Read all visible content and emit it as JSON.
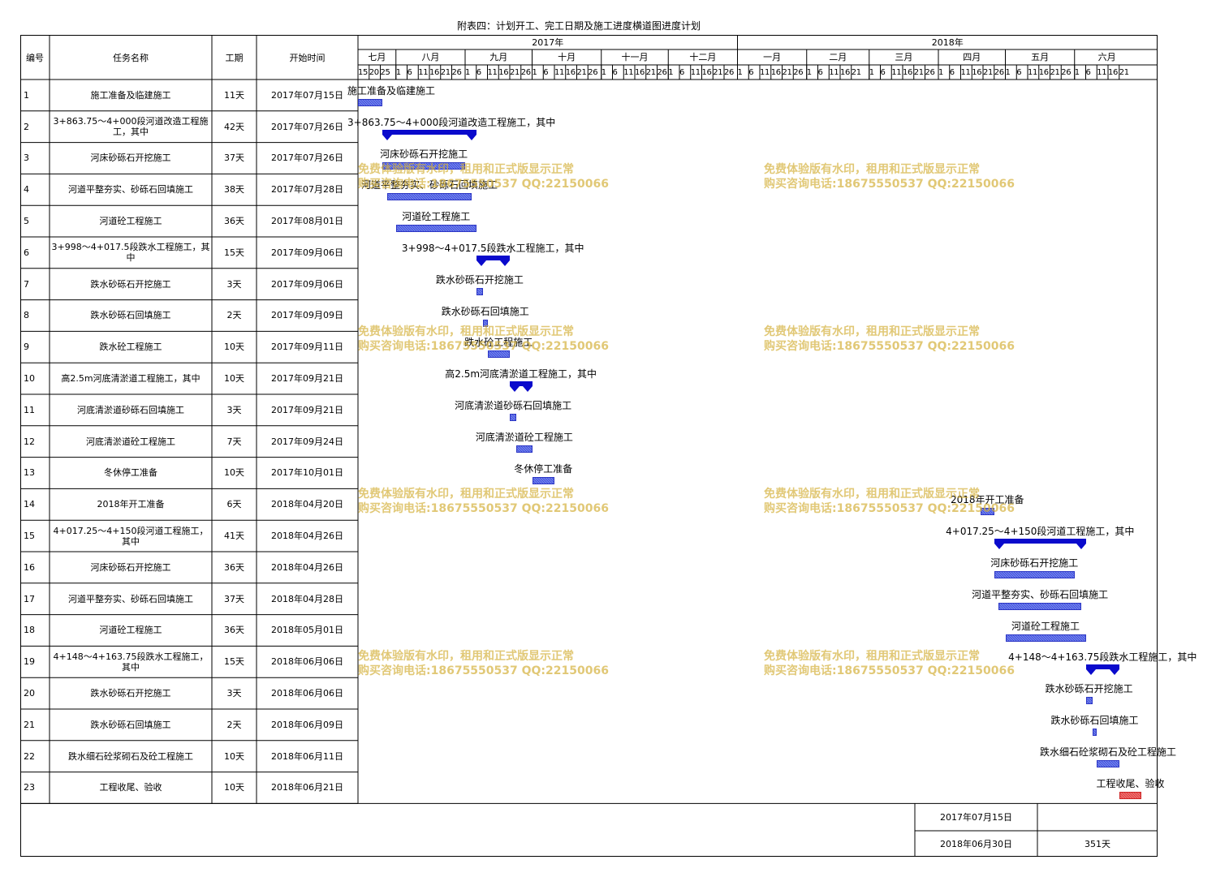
{
  "title": "附表四：计划开工、完工日期及施工进度横道图进度计划",
  "headers": {
    "id": "编号",
    "name": "任务名称",
    "duration": "工期",
    "start": "开始时间"
  },
  "years": [
    "2017年",
    "2018年"
  ],
  "months": [
    "七月",
    "八月",
    "九月",
    "十月",
    "十一月",
    "十二月",
    "一月",
    "二月",
    "三月",
    "四月",
    "五月",
    "六月"
  ],
  "day_ticks": [
    [
      "15",
      "20",
      "25"
    ],
    [
      "1",
      "6",
      "11",
      "16",
      "21",
      "26"
    ],
    [
      "1",
      "6",
      "11",
      "16",
      "21",
      "26"
    ],
    [
      "1",
      "6",
      "11",
      "16",
      "21",
      "26"
    ],
    [
      "1",
      "6",
      "11",
      "16",
      "21",
      "26"
    ],
    [
      "1",
      "6",
      "11",
      "16",
      "21",
      "26"
    ],
    [
      "1",
      "6",
      "11",
      "16",
      "21",
      "26"
    ],
    [
      "1",
      "6",
      "11",
      "16",
      "21"
    ],
    [
      "1",
      "6",
      "11",
      "16",
      "21",
      "26"
    ],
    [
      "1",
      "6",
      "11",
      "16",
      "21",
      "26"
    ],
    [
      "1",
      "6",
      "11",
      "16",
      "21",
      "26"
    ],
    [
      "1",
      "6",
      "11",
      "16",
      "21"
    ]
  ],
  "watermark": {
    "line1": "免费体验版有水印，租用和正式版显示正常",
    "line2": "购买咨询电话:18675550537 QQ:22150066"
  },
  "footer": {
    "start_date": "2017年07月15日",
    "end_date": "2018年06月30日",
    "total": "351天"
  },
  "chart_data": {
    "type": "gantt",
    "title": "附表四：计划开工、完工日期及施工进度横道图进度计划",
    "x_range": [
      "2017-07-15",
      "2018-06-30"
    ],
    "tasks": [
      {
        "id": "1",
        "name": "施工准备及临建施工",
        "duration": "11天",
        "start": "2017年07月15日",
        "start_iso": "2017-07-15",
        "days": 11,
        "kind": "task",
        "bar_label": "施工准备及临建施工"
      },
      {
        "id": "2",
        "name": "3+863.75～4+000段河道改造工程施工，其中",
        "duration": "42天",
        "start": "2017年07月26日",
        "start_iso": "2017-07-26",
        "days": 42,
        "kind": "summary",
        "bar_label": "3+863.75～4+000段河道改造工程施工，其中"
      },
      {
        "id": "3",
        "name": "河床砂砾石开挖施工",
        "duration": "37天",
        "start": "2017年07月26日",
        "start_iso": "2017-07-26",
        "days": 37,
        "kind": "task",
        "bar_label": "河床砂砾石开挖施工"
      },
      {
        "id": "4",
        "name": "河道平整夯实、砂砾石回填施工",
        "duration": "38天",
        "start": "2017年07月28日",
        "start_iso": "2017-07-28",
        "days": 38,
        "kind": "task",
        "bar_label": "河道平整夯实、砂砾石回填施工"
      },
      {
        "id": "5",
        "name": "河道砼工程施工",
        "duration": "36天",
        "start": "2017年08月01日",
        "start_iso": "2017-08-01",
        "days": 36,
        "kind": "task",
        "bar_label": "河道砼工程施工"
      },
      {
        "id": "6",
        "name": "3+998～4+017.5段跌水工程施工，其中",
        "duration": "15天",
        "start": "2017年09月06日",
        "start_iso": "2017-09-06",
        "days": 15,
        "kind": "summary",
        "bar_label": "3+998～4+017.5段跌水工程施工，其中"
      },
      {
        "id": "7",
        "name": "跌水砂砾石开挖施工",
        "duration": "3天",
        "start": "2017年09月06日",
        "start_iso": "2017-09-06",
        "days": 3,
        "kind": "task",
        "bar_label": "跌水砂砾石开挖施工"
      },
      {
        "id": "8",
        "name": "跌水砂砾石回填施工",
        "duration": "2天",
        "start": "2017年09月09日",
        "start_iso": "2017-09-09",
        "days": 2,
        "kind": "task",
        "bar_label": "跌水砂砾石回填施工"
      },
      {
        "id": "9",
        "name": "跌水砼工程施工",
        "duration": "10天",
        "start": "2017年09月11日",
        "start_iso": "2017-09-11",
        "days": 10,
        "kind": "task",
        "bar_label": "跌水砼工程施工"
      },
      {
        "id": "10",
        "name": "高2.5m河底清淤道工程施工，其中",
        "duration": "10天",
        "start": "2017年09月21日",
        "start_iso": "2017-09-21",
        "days": 10,
        "kind": "summary",
        "bar_label": "高2.5m河底清淤道工程施工，其中"
      },
      {
        "id": "11",
        "name": "河底清淤道砂砾石回填施工",
        "duration": "3天",
        "start": "2017年09月21日",
        "start_iso": "2017-09-21",
        "days": 3,
        "kind": "task",
        "bar_label": "河底清淤道砂砾石回填施工"
      },
      {
        "id": "12",
        "name": "河底清淤道砼工程施工",
        "duration": "7天",
        "start": "2017年09月24日",
        "start_iso": "2017-09-24",
        "days": 7,
        "kind": "task",
        "bar_label": "河底清淤道砼工程施工"
      },
      {
        "id": "13",
        "name": "冬休停工准备",
        "duration": "10天",
        "start": "2017年10月01日",
        "start_iso": "2017-10-01",
        "days": 10,
        "kind": "task",
        "bar_label": "冬休停工准备"
      },
      {
        "id": "14",
        "name": "2018年开工准备",
        "duration": "6天",
        "start": "2018年04月20日",
        "start_iso": "2018-04-20",
        "days": 6,
        "kind": "task",
        "bar_label": "2018年开工准备"
      },
      {
        "id": "15",
        "name": "4+017.25～4+150段河道工程施工，其中",
        "duration": "41天",
        "start": "2018年04月26日",
        "start_iso": "2018-04-26",
        "days": 41,
        "kind": "summary",
        "bar_label": "4+017.25～4+150段河道工程施工，其中"
      },
      {
        "id": "16",
        "name": "河床砂砾石开挖施工",
        "duration": "36天",
        "start": "2018年04月26日",
        "start_iso": "2018-04-26",
        "days": 36,
        "kind": "task",
        "bar_label": "河床砂砾石开挖施工"
      },
      {
        "id": "17",
        "name": "河道平整夯实、砂砾石回填施工",
        "duration": "37天",
        "start": "2018年04月28日",
        "start_iso": "2018-04-28",
        "days": 37,
        "kind": "task",
        "bar_label": "河道平整夯实、砂砾石回填施工"
      },
      {
        "id": "18",
        "name": "河道砼工程施工",
        "duration": "36天",
        "start": "2018年05月01日",
        "start_iso": "2018-05-01",
        "days": 36,
        "kind": "task",
        "bar_label": "河道砼工程施工"
      },
      {
        "id": "19",
        "name": "4+148～4+163.75段跌水工程施工，其中",
        "duration": "15天",
        "start": "2018年06月06日",
        "start_iso": "2018-06-06",
        "days": 15,
        "kind": "summary",
        "bar_label": "4+148～4+163.75段跌水工程施工，其中"
      },
      {
        "id": "20",
        "name": "跌水砂砾石开挖施工",
        "duration": "3天",
        "start": "2018年06月06日",
        "start_iso": "2018-06-06",
        "days": 3,
        "kind": "task",
        "bar_label": "跌水砂砾石开挖施工"
      },
      {
        "id": "21",
        "name": "跌水砂砾石回填施工",
        "duration": "2天",
        "start": "2018年06月09日",
        "start_iso": "2018-06-09",
        "days": 2,
        "kind": "task",
        "bar_label": "跌水砂砾石回填施工"
      },
      {
        "id": "22",
        "name": "跌水细石砼浆砌石及砼工程施工",
        "duration": "10天",
        "start": "2018年06月11日",
        "start_iso": "2018-06-11",
        "days": 10,
        "kind": "task",
        "bar_label": "跌水细石砼浆砌石及砼工程施工"
      },
      {
        "id": "23",
        "name": "工程收尾、验收",
        "duration": "10天",
        "start": "2018年06月21日",
        "start_iso": "2018-06-21",
        "days": 10,
        "kind": "task",
        "bar_label": "工程收尾、验收",
        "color": "#e23b3b"
      }
    ]
  }
}
